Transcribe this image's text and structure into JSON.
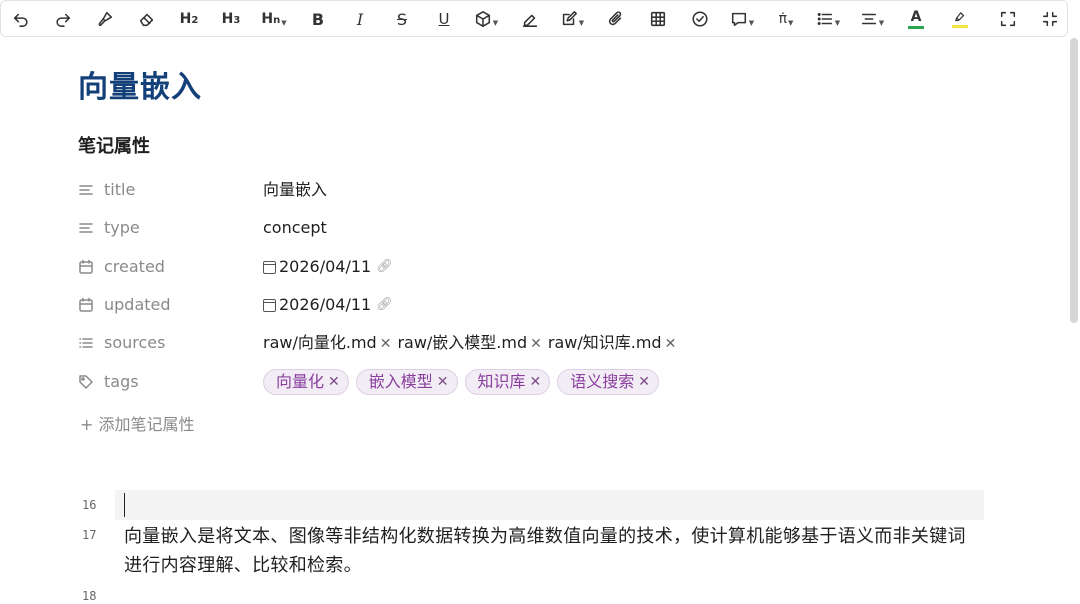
{
  "toolbar": {
    "h2": "H",
    "h2_sub": "2",
    "h3": "H",
    "h3_sub": "3",
    "hn": "H",
    "hn_sub": "n",
    "bold": "B",
    "italic": "I",
    "strike": "S",
    "underline": "U",
    "font_color_letter": "A",
    "font_color_accent": "#2ea44f",
    "highlight_accent": "#f5e642"
  },
  "page": {
    "title": "向量嵌入",
    "section_title": "笔记属性"
  },
  "properties": {
    "title": {
      "key": "title",
      "value": "向量嵌入"
    },
    "type": {
      "key": "type",
      "value": "concept"
    },
    "created": {
      "key": "created",
      "value": "2026/04/11"
    },
    "updated": {
      "key": "updated",
      "value": "2026/04/11"
    },
    "sources": {
      "key": "sources",
      "items": [
        "raw/向量化.md",
        "raw/嵌入模型.md",
        "raw/知识库.md"
      ]
    },
    "tags": {
      "key": "tags",
      "items": [
        "向量化",
        "嵌入模型",
        "知识库",
        "语义搜索"
      ]
    }
  },
  "add_property": "+ 添加笔记属性",
  "editor": {
    "line_numbers": [
      "16",
      "17",
      "18"
    ],
    "paragraph": "向量嵌入是将文本、图像等非结构化数据转换为高维数值向量的技术，使计算机能够基于语义而非关键词进行内容理解、比较和检索。"
  },
  "icons": {
    "undo": "undo-icon",
    "redo": "redo-icon",
    "format_painter": "brush-icon",
    "clear_format": "eraser-icon",
    "cube": "cube-icon",
    "pen": "pen-icon",
    "edit": "edit-icon",
    "attachment": "paperclip-icon",
    "table": "table-icon",
    "check": "check-circle-icon",
    "comment": "comment-icon",
    "math": "math-icon",
    "list": "list-icon",
    "align": "align-icon",
    "fullscreen": "fullscreen-icon",
    "collapse": "collapse-icon"
  }
}
